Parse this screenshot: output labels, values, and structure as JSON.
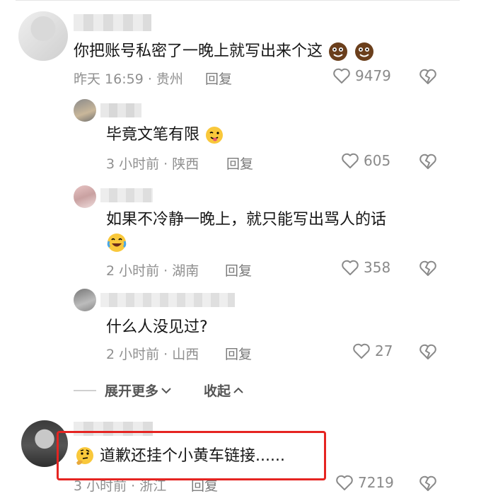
{
  "comments": [
    {
      "text": "你把账号私密了一晚上就写出来个这",
      "meta": "昨天 16:59 · 贵州",
      "reply": "回复",
      "likes": "9479"
    }
  ],
  "replies": [
    {
      "text": "毕竟文笔有限",
      "meta": "3 小时前 · 陕西",
      "reply": "回复",
      "likes": "605"
    },
    {
      "text": "如果不冷静一晚上，就只能写出骂人的话",
      "meta": "2 小时前 · 湖南",
      "reply": "回复",
      "likes": "358"
    },
    {
      "text": "什么人没见过?",
      "meta": "2 小时前 · 山西",
      "reply": "回复",
      "likes": "27"
    }
  ],
  "expand_more": "展开更多",
  "collapse": "收起",
  "highlighted_comment": {
    "text": "道歉还挂个小黄车链接......",
    "meta": "3 小时前 · 浙江",
    "reply": "回复",
    "likes": "7219"
  },
  "colors": {
    "text": "#161616",
    "meta": "#8f8f8f",
    "highlight_border": "#e52421",
    "icon": "#8a8a8a"
  },
  "icons": [
    "heart-icon",
    "heart-broken-icon",
    "chevron-down-icon",
    "chevron-up-icon"
  ]
}
